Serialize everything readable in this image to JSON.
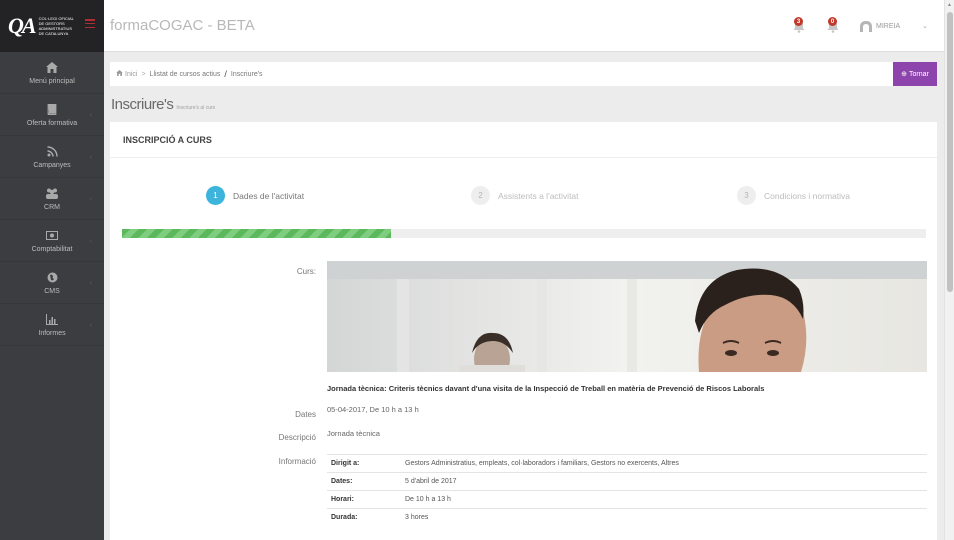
{
  "sidebar": {
    "brand_logo": "QA",
    "brand_text": "COL·LEGI OFICIAL DE GESTORS ADMINISTRATIUS DE CATALUNYA",
    "items": [
      {
        "label": "Menú principal",
        "icon": "home-icon"
      },
      {
        "label": "Oferta formativa",
        "icon": "book-icon"
      },
      {
        "label": "Campanyes",
        "icon": "rss-icon"
      },
      {
        "label": "CRM",
        "icon": "users-icon"
      },
      {
        "label": "Comptabilitat",
        "icon": "money-icon"
      },
      {
        "label": "CMS",
        "icon": "globe-icon"
      },
      {
        "label": "Informes",
        "icon": "bar-chart-icon"
      }
    ]
  },
  "header": {
    "title": "formaCOGAC - BETA",
    "notifications": [
      {
        "count": "3"
      },
      {
        "count": "0"
      }
    ],
    "user_name": "MIREIA"
  },
  "breadcrumb": {
    "home": "Inici",
    "items": [
      "Llistat de cursos actius",
      "Inscriure's"
    ],
    "back_button": "Tornar"
  },
  "page": {
    "title": "Inscriure's",
    "subtitle": "Inscriure's al curs"
  },
  "form": {
    "heading": "INSCRIPCIÓ A CURS",
    "steps": [
      {
        "num": "1",
        "label": "Dades de l'activitat",
        "active": true
      },
      {
        "num": "2",
        "label": "Assistents a l'activitat",
        "active": false
      },
      {
        "num": "3",
        "label": "Condicions i normativa",
        "active": false
      }
    ],
    "progress_fraction": 0.335,
    "labels": {
      "curs": "Curs:",
      "dates": "Dates",
      "descripcio": "Descripció",
      "informacio": "Informació"
    },
    "course_title": "Jornada tècnica: Criteris tècnics davant d'una visita de la Inspecció de Treball en matèria de Prevenció de Riscos Laborals",
    "dates_value": "05-04-2017, De 10 h a 13 h",
    "description_value": "Jornada tècnica",
    "info_rows": [
      {
        "key": "Dirigit a:",
        "value": "Gestors Administratius, empleats, col·laboradors i familiars, Gestors no exercents, Altres"
      },
      {
        "key": "Dates:",
        "value": "5 d'abril de 2017"
      },
      {
        "key": "Horari:",
        "value": "De 10 h a 13 h"
      },
      {
        "key": "Durada:",
        "value": "3 hores"
      }
    ]
  },
  "colors": {
    "sidebar_bg": "#3b3d40",
    "accent_blue": "#3cb4dc",
    "progress_green": "#5cb85c",
    "back_button_purple": "#8e44ad",
    "badge_red": "#c0392b"
  }
}
